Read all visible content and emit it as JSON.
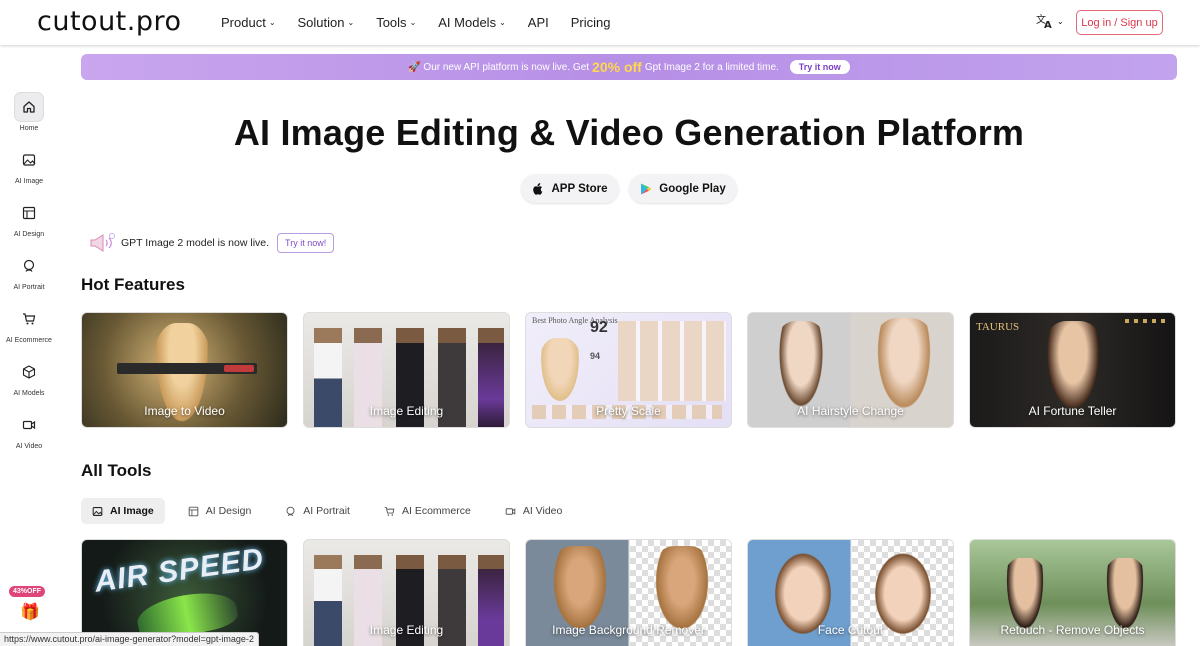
{
  "header": {
    "logo": "cutout.pro",
    "nav": [
      {
        "label": "Product",
        "has_menu": true
      },
      {
        "label": "Solution",
        "has_menu": true
      },
      {
        "label": "Tools",
        "has_menu": true
      },
      {
        "label": "AI Models",
        "has_menu": true
      },
      {
        "label": "API",
        "has_menu": false
      },
      {
        "label": "Pricing",
        "has_menu": false
      }
    ],
    "language_icon": "translate-icon",
    "login_label": "Log in / Sign up"
  },
  "sidebar": {
    "items": [
      {
        "label": "Home",
        "icon": "home-icon",
        "active": true
      },
      {
        "label": "AI Image",
        "icon": "image-icon",
        "active": false
      },
      {
        "label": "AI Design",
        "icon": "layout-icon",
        "active": false
      },
      {
        "label": "AI Portrait",
        "icon": "portrait-icon",
        "active": false
      },
      {
        "label": "AI Ecommerce",
        "icon": "cart-icon",
        "active": false
      },
      {
        "label": "AI Models",
        "icon": "cube-icon",
        "active": false
      },
      {
        "label": "AI Video",
        "icon": "video-icon",
        "active": false
      }
    ]
  },
  "banner": {
    "prefix": "🚀 Our new API platform is now live. Get",
    "highlight": "20% off",
    "suffix": "Gpt Image 2 for a limited time.",
    "cta": "Try it now"
  },
  "hero": {
    "title": "AI Image Editing & Video Generation Platform",
    "app_store": "APP Store",
    "google_play": "Google Play"
  },
  "notice": {
    "text": "GPT Image 2 model is now live.",
    "cta": "Try it now!"
  },
  "hot_features": {
    "heading": "Hot Features",
    "cards": [
      "Image to Video",
      "Image Editing",
      "Pretty Scale",
      "AI Hairstyle Change",
      "AI Fortune Teller"
    ]
  },
  "all_tools": {
    "heading": "All Tools",
    "tabs": [
      {
        "label": "AI Image",
        "icon": "image-icon",
        "active": true
      },
      {
        "label": "AI Design",
        "icon": "layout-icon",
        "active": false
      },
      {
        "label": "AI Portrait",
        "icon": "portrait-icon",
        "active": false
      },
      {
        "label": "AI Ecommerce",
        "icon": "cart-icon",
        "active": false
      },
      {
        "label": "AI Video",
        "icon": "video-icon",
        "active": false
      }
    ],
    "cards": [
      "",
      "Image Editing",
      "Image Background Remover",
      "Face Cutout",
      "Retouch - Remove Objects"
    ],
    "first_card_art_text": "AIR SPEED"
  },
  "pretty_scale_text": {
    "heading": "Best Photo Angle Analysis",
    "score": "92",
    "sub": "94"
  },
  "fortune_text": "TAURUS",
  "promo_badge": "43%OFF",
  "status_url": "https://www.cutout.pro/ai-image-generator?model=gpt-image-2"
}
